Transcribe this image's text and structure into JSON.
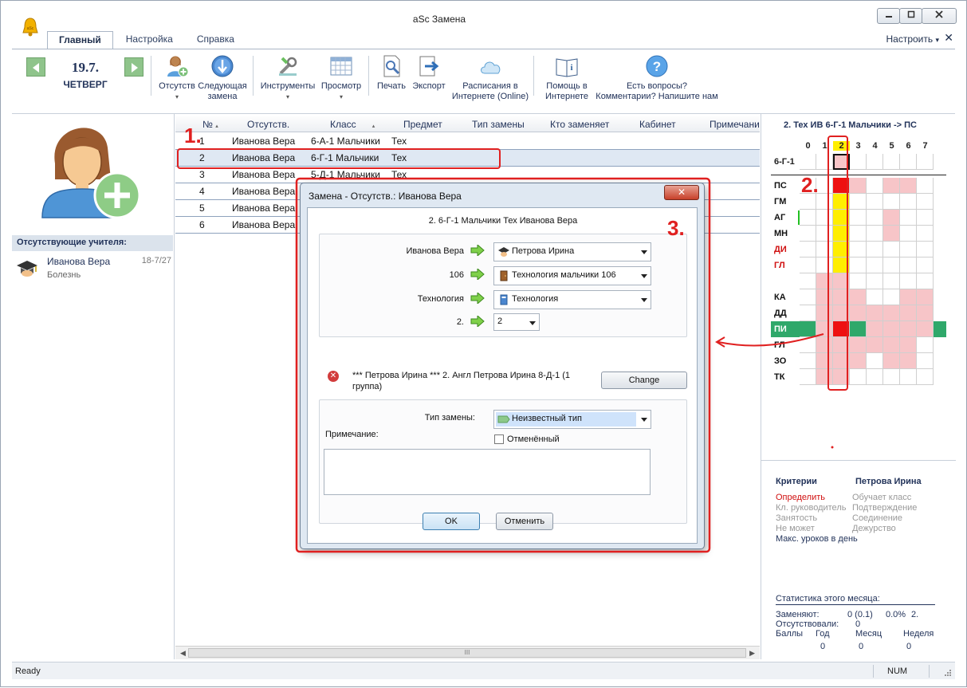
{
  "window": {
    "title": "aSc Замена"
  },
  "ribbon_tabs": [
    {
      "label": "Главный",
      "active": true
    },
    {
      "label": "Настройка",
      "active": false
    },
    {
      "label": "Справка",
      "active": false
    }
  ],
  "customize": {
    "label": "Настроить",
    "caret": "▾",
    "close": "✕"
  },
  "date": {
    "day_month": "19.7.",
    "weekday": "ЧЕТВЕРГ"
  },
  "ribbon_buttons": {
    "absent": {
      "line1": "Отсутств",
      "caret": "▾"
    },
    "next": {
      "line1": "Следующая",
      "line2": "замена"
    },
    "tools": {
      "line1": "Инструменты",
      "caret": "▾"
    },
    "view": {
      "line1": "Просмотр",
      "caret": "▾"
    },
    "print": {
      "line1": "Печать"
    },
    "export": {
      "line1": "Экспорт"
    },
    "online": {
      "line1": "Расписания в",
      "line2": "Интернете (Online)"
    },
    "help": {
      "line1": "Помощь в",
      "line2": "Интернете"
    },
    "questions": {
      "line1": "Есть вопросы?",
      "line2": "Комментарии? Напишите нам"
    }
  },
  "left_panel": {
    "header": "Отсутствующие учителя:",
    "teachers": [
      {
        "name": "Иванова Вера",
        "reason": "Болезнь",
        "date": "18-7/27"
      }
    ]
  },
  "table": {
    "columns": [
      "№",
      "Отсутств.",
      "Класс",
      "Предмет",
      "Тип замены",
      "Кто заменяет",
      "Кабинет",
      "Примечани"
    ],
    "sort_caret": "▴",
    "rows": [
      {
        "num": "1",
        "teacher": "Иванова Вера",
        "class": "6-А-1 Мальчики",
        "subject": "Тех"
      },
      {
        "num": "2",
        "teacher": "Иванова Вера",
        "class": "6-Г-1 Мальчики",
        "subject": "Тех"
      },
      {
        "num": "3",
        "teacher": "Иванова Вера",
        "class": "5-Д-1 Мальчики",
        "subject": "Тех"
      },
      {
        "num": "4",
        "teacher": "Иванова Вера",
        "class": "",
        "subject": ""
      },
      {
        "num": "5",
        "teacher": "Иванова Вера",
        "class": "",
        "subject": ""
      },
      {
        "num": "6",
        "teacher": "Иванова Вера",
        "class": "",
        "subject": ""
      }
    ],
    "scroll_grip": "III"
  },
  "right_panel": {
    "title": "2. Тех ИВ 6-Г-1 Мальчики -> ПС",
    "periods": [
      "0",
      "1",
      "2",
      "3",
      "4",
      "5",
      "6",
      "7"
    ],
    "class_row": "6-Г-1",
    "rows": [
      {
        "label": "ПС",
        "color": "#111111"
      },
      {
        "label": "ГМ",
        "color": "#111111"
      },
      {
        "label": "АГ",
        "color": "#111111"
      },
      {
        "label": "МН",
        "color": "#111111"
      },
      {
        "label": "ДИ",
        "color": "#d01010"
      },
      {
        "label": "ГЛ",
        "color": "#d01010"
      },
      {
        "label": "",
        "color": "#111111"
      },
      {
        "label": "КА",
        "color": "#111111"
      },
      {
        "label": "ДД",
        "color": "#111111"
      },
      {
        "label": "ПИ",
        "color": "#ffffff"
      },
      {
        "label": "ГЛ",
        "color": "#111111"
      },
      {
        "label": "ЗО",
        "color": "#111111"
      },
      {
        "label": "ТК",
        "color": "#111111"
      }
    ],
    "criteria": {
      "head_left": "Критерии",
      "head_right": "Петрова Ирина",
      "left": [
        "Определить",
        "Кл. руководитель",
        "Занятость",
        "Не может",
        "Макс. уроков в день"
      ],
      "right": [
        "Обучает класс",
        "Подтверждение",
        "Соединение",
        "Дежурство"
      ]
    },
    "stats": {
      "title": "Статистика этого месяца:",
      "replace_label": "Заменяют:",
      "replace_value": "0 (0.1)",
      "replace_pct": "0.0%",
      "replace_num": "2.",
      "absent_label": "Отсутствовали:",
      "absent_value": "0",
      "points_label": "Баллы",
      "year_label": "Год",
      "month_label": "Месяц",
      "week_label": "Неделя",
      "year_value": "0",
      "month_value": "0",
      "week_value": "0"
    }
  },
  "status": {
    "text": "Ready",
    "num": "NUM"
  },
  "dialog": {
    "title": "Замена - Отсутств.: Иванова Вера",
    "close": "✕",
    "subtitle": "2. 6-Г-1 Мальчики Тех Иванова Вера",
    "teacher_label": "Иванова Вера",
    "teacher_value": "Петрова Ирина",
    "room_label": "106",
    "room_value": "Технология мальчики 106",
    "subject_label": "Технология",
    "subject_value": "Технология",
    "period_label": "2.",
    "period_value": "2",
    "conflict": "*** Петрова Ирина *** 2. Англ Петрова Ирина 8-Д-1 (1 группа)",
    "change_btn": "Change",
    "type_label": "Тип замены:",
    "type_value": "Неизвестный тип",
    "cancelled_label": "Отменённый",
    "note_label": "Примечание:",
    "ok_btn": "OK",
    "cancel_btn": "Отменить"
  },
  "annotations": [
    "1.",
    "2.",
    "3."
  ],
  "colors": {
    "accent": "#22335a",
    "annotation": "#e02020",
    "yellow": "#ffee00",
    "pink": "#f7c5c8",
    "green": "#2fa86a",
    "red": "#ee1111"
  }
}
